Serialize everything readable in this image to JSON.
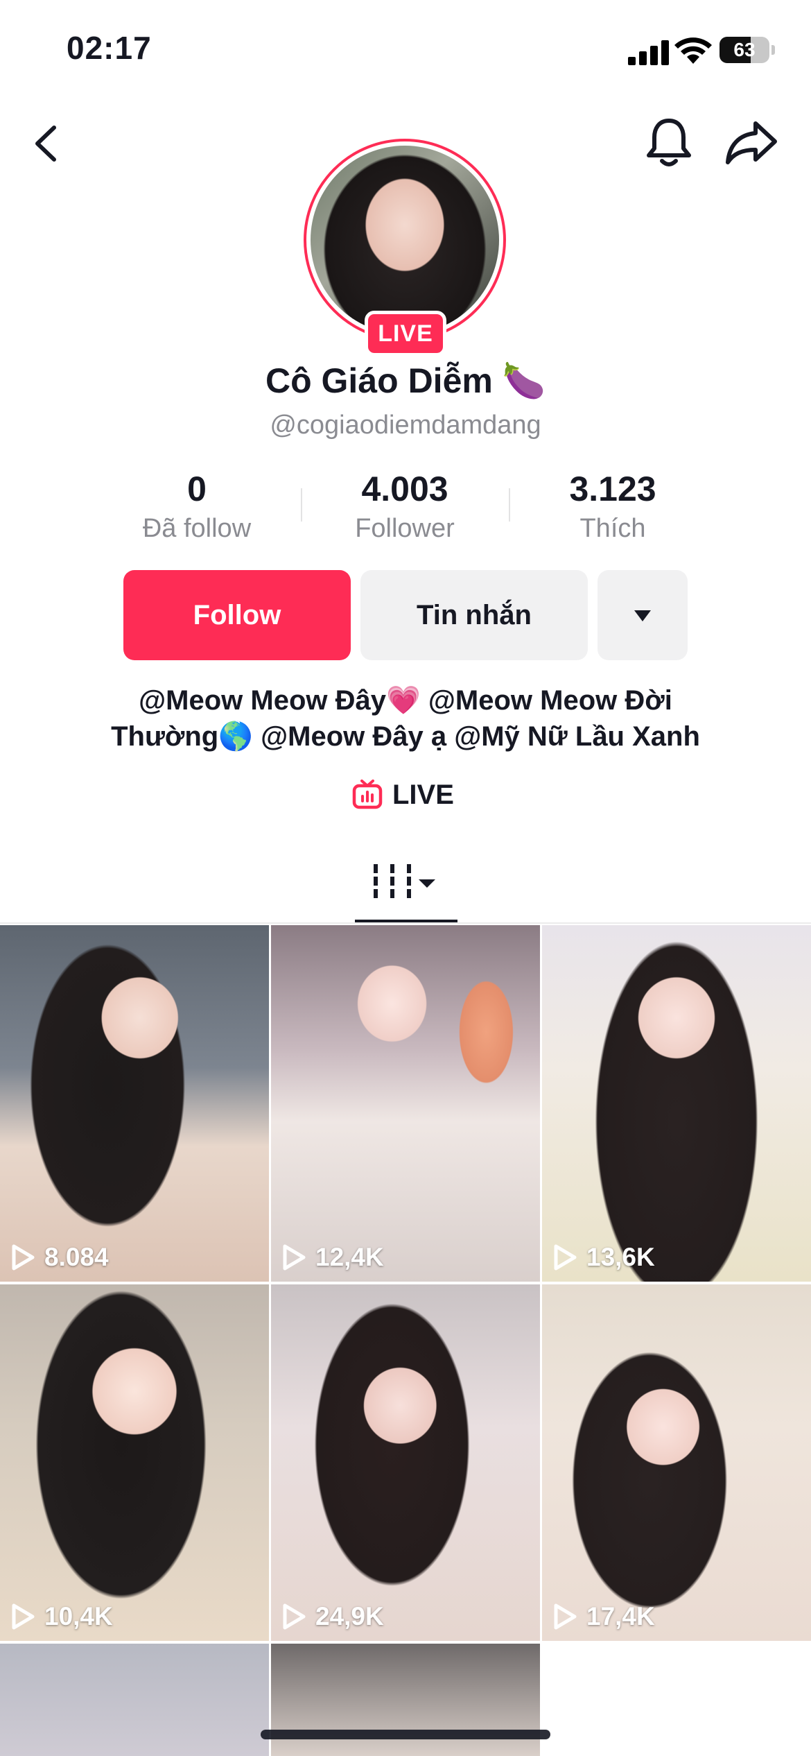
{
  "status_bar": {
    "time": "02:17",
    "battery": "63",
    "battery_level": 0.63
  },
  "profile": {
    "display_name": "Cô Giáo Diễm 🍆",
    "username": "@cogiaodiemdamdang",
    "live_badge": "LIVE"
  },
  "stats": [
    {
      "value": "0",
      "label": "Đã follow"
    },
    {
      "value": "4.003",
      "label": "Follower"
    },
    {
      "value": "3.123",
      "label": "Thích"
    }
  ],
  "actions": {
    "follow": "Follow",
    "message": "Tin nhắn"
  },
  "bio": {
    "line1": "@Meow Meow Đây💗 @Meow Meow Đời",
    "line2": "Thường🌎 @Meow Đây ạ @Mỹ Nữ Lầu Xanh",
    "live_link": "LIVE"
  },
  "icons": [
    "back-icon",
    "bell-icon",
    "share-icon",
    "chevron-down-icon",
    "live-tv-icon",
    "videos-grid-icon",
    "play-icon"
  ],
  "colors": {
    "accent": "#fe2c55",
    "text": "#161823",
    "muted": "#8a8b91",
    "button_bg": "#f1f1f2"
  },
  "videos": [
    {
      "views": "8.084"
    },
    {
      "views": "12,4K"
    },
    {
      "views": "13,6K"
    },
    {
      "views": "10,4K"
    },
    {
      "views": "24,9K"
    },
    {
      "views": "17,4K"
    }
  ]
}
